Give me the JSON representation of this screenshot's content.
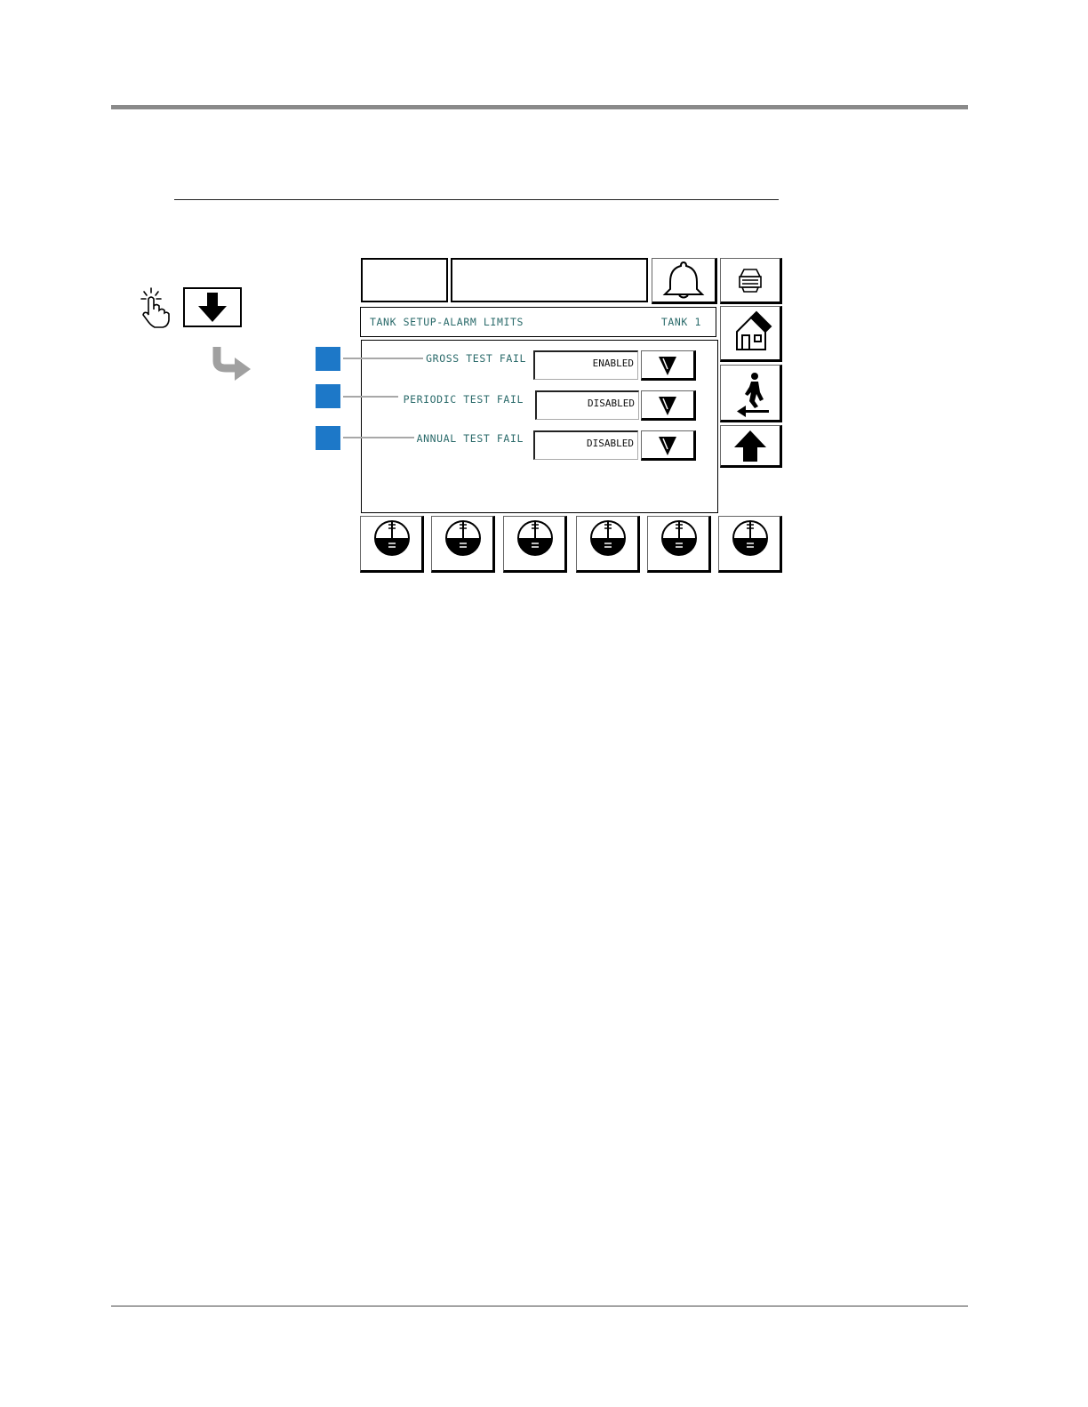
{
  "screen": {
    "title": "TANK SETUP-ALARM LIMITS",
    "tank": "TANK 1"
  },
  "fields": [
    {
      "label": "GROSS TEST FAIL",
      "value": "ENABLED"
    },
    {
      "label": "PERIODIC TEST FAIL",
      "value": "DISABLED"
    },
    {
      "label": "ANNUAL TEST FAIL",
      "value": "DISABLED"
    }
  ],
  "side_buttons": [
    "printer-icon",
    "home-icon",
    "exit-icon",
    "up-arrow-icon"
  ],
  "tank_buttons": [
    "tank-gauge-icon",
    "tank-gauge-icon",
    "tank-gauge-icon",
    "tank-gauge-icon",
    "tank-gauge-icon",
    "tank-gauge-icon"
  ],
  "colors": {
    "callout": "#1d78c8",
    "label_text": "#2a6a6a",
    "rule": "#8a8a8a"
  }
}
